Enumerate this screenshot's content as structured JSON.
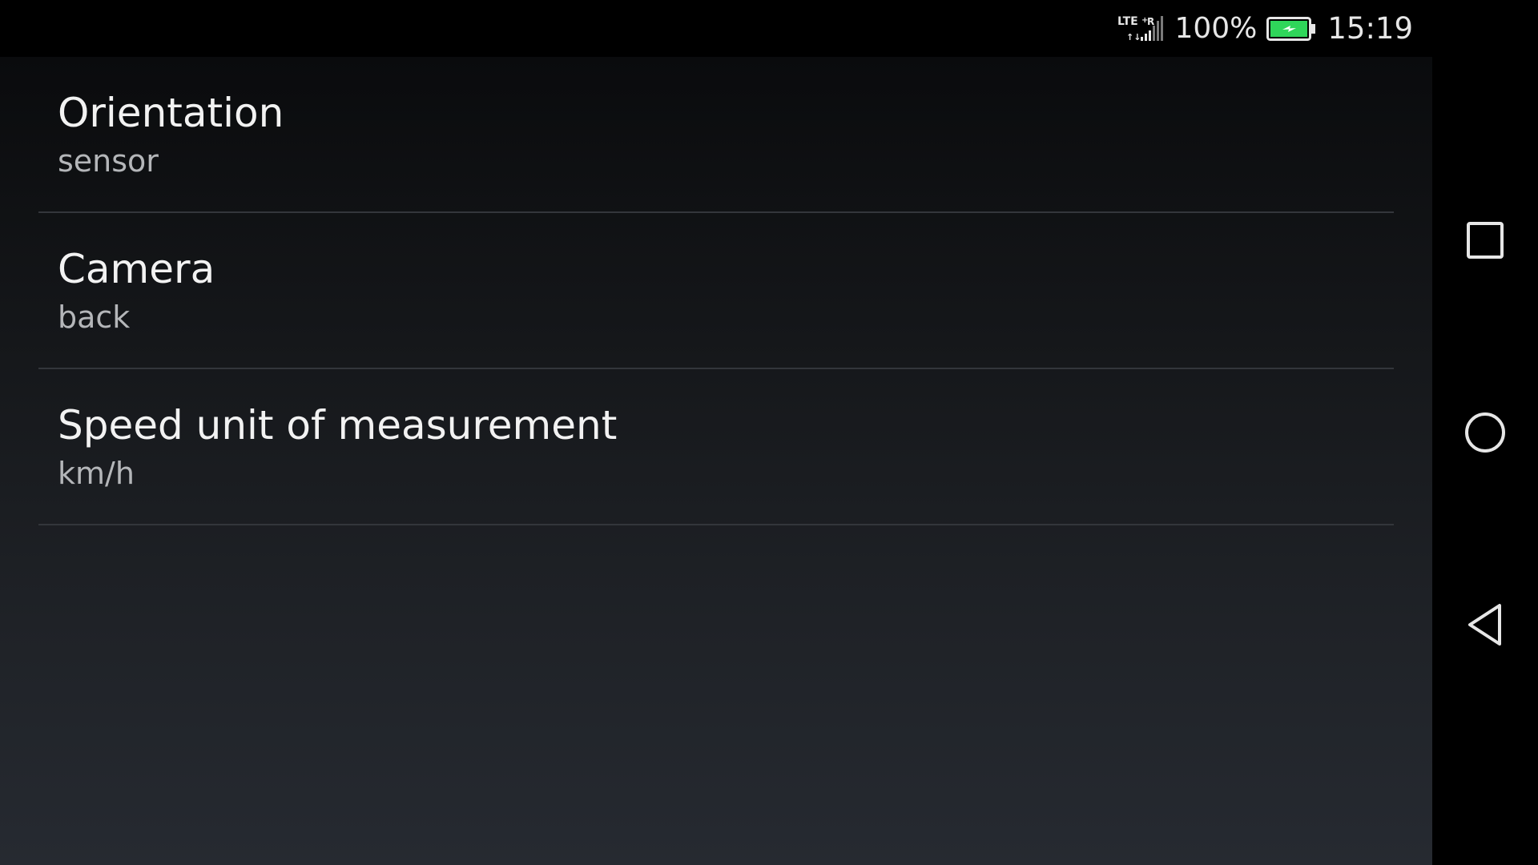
{
  "status_bar": {
    "network_label": "LTE+R",
    "battery_percent": "100%",
    "battery_level": 1.0,
    "battery_color": "#2fd65a",
    "time": "15:19"
  },
  "settings": {
    "items": [
      {
        "title": "Orientation",
        "summary": "sensor"
      },
      {
        "title": "Camera",
        "summary": "back"
      },
      {
        "title": "Speed unit of measurement",
        "summary": "km/h"
      }
    ]
  },
  "nav_bar": {
    "icons": [
      "recents-square-icon",
      "home-circle-icon",
      "back-triangle-icon"
    ]
  }
}
